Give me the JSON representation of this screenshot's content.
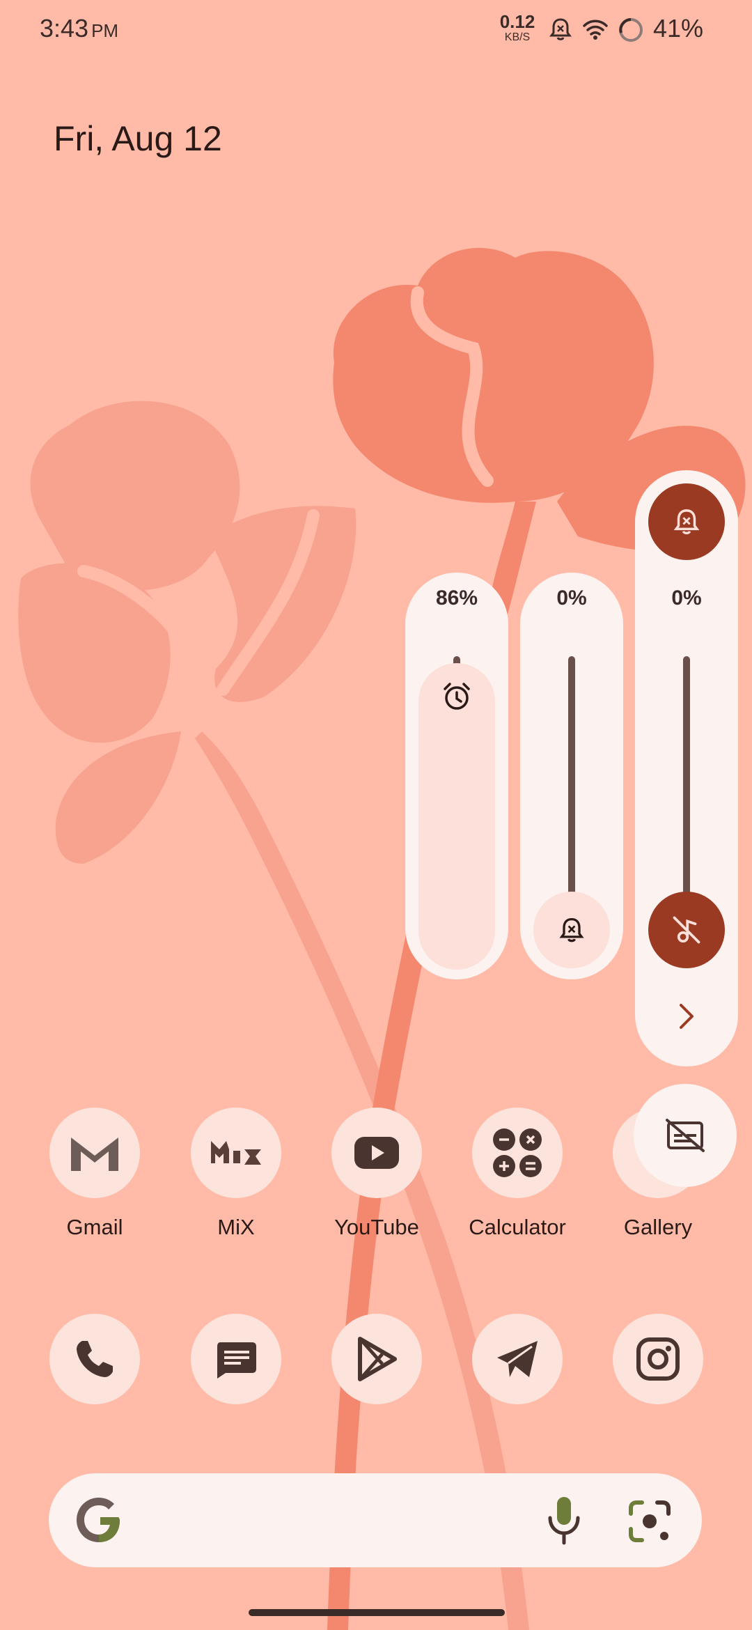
{
  "status_bar": {
    "time": "3:43",
    "ampm": "PM",
    "net_speed_value": "0.12",
    "net_speed_unit": "KB/S",
    "battery_percent": "41%",
    "icons": [
      "bell-muted-icon",
      "wifi-icon",
      "battery-saver-ring-icon"
    ]
  },
  "home": {
    "date": "Fri, Aug 12"
  },
  "volume_panel": {
    "alarm": {
      "percent": "86%",
      "level": 0.86,
      "icon": "alarm-clock-icon"
    },
    "ring": {
      "percent": "0%",
      "level": 0.0,
      "icon": "bell-muted-icon"
    },
    "media": {
      "percent": "0%",
      "level": 0.0,
      "icon": "music-off-icon"
    },
    "ringer_mode_icon": "bell-muted-icon",
    "expand_icon": "chevron-right-icon",
    "captions_icon": "captions-off-icon"
  },
  "apps": [
    {
      "label": "Gmail",
      "icon": "gmail-icon"
    },
    {
      "label": "MiX",
      "icon": "mix-icon"
    },
    {
      "label": "YouTube",
      "icon": "youtube-icon"
    },
    {
      "label": "Calculator",
      "icon": "calculator-icon"
    },
    {
      "label": "Gallery",
      "icon": "gallery-icon"
    }
  ],
  "dock": [
    {
      "icon": "phone-icon"
    },
    {
      "icon": "messages-icon"
    },
    {
      "icon": "play-store-icon"
    },
    {
      "icon": "telegram-icon"
    },
    {
      "icon": "instagram-icon"
    }
  ],
  "search_bar": {
    "logo": "google-g-icon",
    "mic_icon": "mic-icon",
    "lens_icon": "lens-icon"
  },
  "colors": {
    "background": "#FFBBA8",
    "panel": "#FCF2EF",
    "accent": "#9A3A22",
    "flower_dark": "#F4886F",
    "flower_light": "#F7A390"
  }
}
